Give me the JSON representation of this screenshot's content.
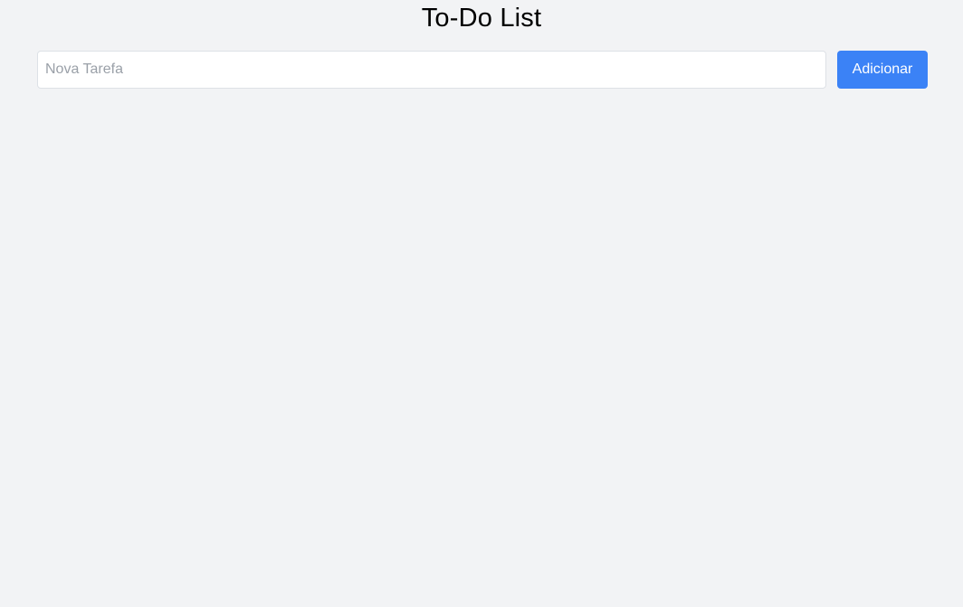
{
  "header": {
    "title": "To-Do List"
  },
  "task_form": {
    "input_value": "",
    "input_placeholder": "Nova Tarefa",
    "add_button_label": "Adicionar"
  },
  "tasks": [],
  "colors": {
    "page_background": "#f2f3f5",
    "accent": "#3b82f6",
    "input_border": "#dde1e6",
    "placeholder_text": "#9aa0a8"
  }
}
